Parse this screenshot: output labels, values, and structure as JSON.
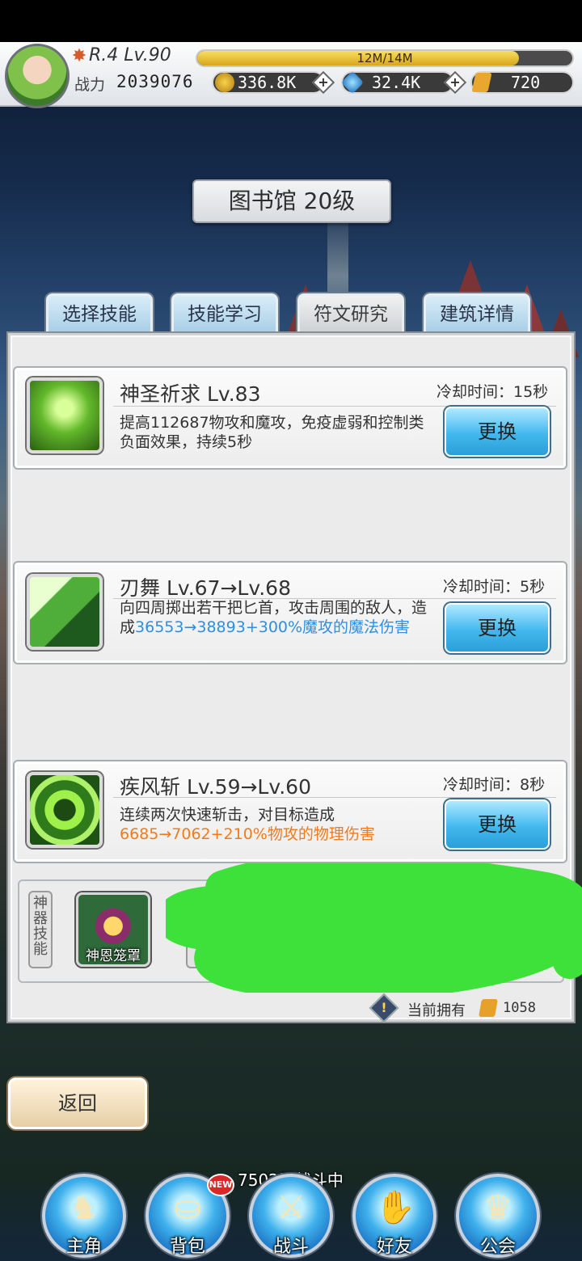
{
  "header": {
    "rank_level": "R.4 Lv.90",
    "exp_text": "12M/14M",
    "exp_progress": 0.857,
    "power_label": "战力",
    "power_value": "2039076",
    "gold": "336.8K",
    "gems": "32.4K",
    "scrolls": "720"
  },
  "title": "图书馆 20级",
  "tabs": [
    {
      "label": "选择技能",
      "active": false
    },
    {
      "label": "技能学习",
      "active": false
    },
    {
      "label": "符文研究",
      "active": true
    },
    {
      "label": "建筑详情",
      "active": false
    }
  ],
  "skills": [
    {
      "name": "神圣祈求 Lv.83",
      "cooldown": "冷却时间：15秒",
      "desc": "提高112687物攻和魔攻，免疫虚弱和控制类负面效果，持续5秒",
      "button": "更换",
      "icon": "praying-figure-icon"
    },
    {
      "name": "刃舞 Lv.67→Lv.68",
      "cooldown": "冷却时间：5秒",
      "desc_prefix": "向四周掷出若干把匕首，攻击周围的敌人，造成",
      "desc_highlight": "36553→38893+300%魔攻的魔法伤害",
      "button": "更换",
      "icon": "blade-dance-icon"
    },
    {
      "name": "疾风斩 Lv.59→Lv.60",
      "cooldown": "冷却时间：8秒",
      "desc_prefix": "连续两次快速斩击，对目标造成",
      "desc_highlight": "6685→7062+210%物攻的物理伤害",
      "button": "更换",
      "icon": "wind-slash-icon"
    }
  ],
  "artifact": {
    "label": "神器技能",
    "name": "神恩笼罩"
  },
  "owned": {
    "label": "当前拥有",
    "value": "1058"
  },
  "back_button": "返回",
  "battle_status": "7502层战斗中",
  "new_badge": "NEW",
  "nav": [
    {
      "label": "主角",
      "icon": "hero-icon"
    },
    {
      "label": "背包",
      "icon": "backpack-icon"
    },
    {
      "label": "战斗",
      "icon": "crossed-swords-icon"
    },
    {
      "label": "好友",
      "icon": "handshake-icon"
    },
    {
      "label": "公会",
      "icon": "guild-crest-icon"
    }
  ],
  "colors": {
    "highlight_blue": "#2f8ee0",
    "highlight_orange": "#f27a1a",
    "button_blue": "#43b8ef",
    "redaction_green": "#3ee03a"
  }
}
